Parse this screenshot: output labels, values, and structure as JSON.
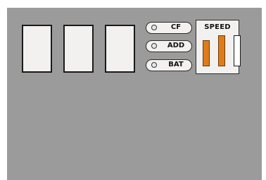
{
  "indicators": [
    {
      "label": "CF",
      "icon": "led-icon"
    },
    {
      "label": "ADD",
      "icon": "led-icon"
    },
    {
      "label": "BAT",
      "icon": "led-icon"
    }
  ],
  "speed_meter": {
    "title": "SPEED",
    "bars": [
      {
        "level": 0.5,
        "color": "#e07b1a"
      },
      {
        "level": 0.8,
        "color": "#e07b1a"
      },
      {
        "level": 0.0,
        "color": "#e07b1a"
      }
    ]
  },
  "colors": {
    "panel": "#9b9b9b",
    "slot": "#f2f1ef",
    "accent": "#e07b1a"
  }
}
